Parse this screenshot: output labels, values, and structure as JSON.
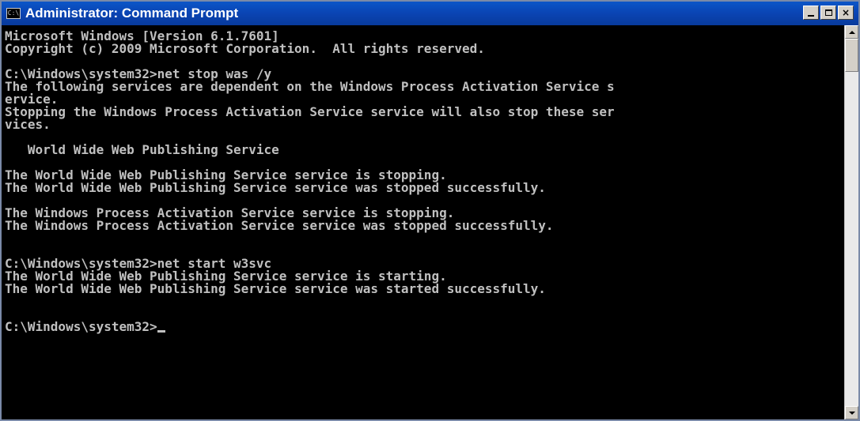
{
  "window": {
    "title": "Administrator: Command Prompt",
    "app_icon_text": "C:\\",
    "buttons": {
      "minimize": "minimize",
      "maximize": "maximize",
      "close": "×"
    }
  },
  "console": {
    "lines": [
      "Microsoft Windows [Version 6.1.7601]",
      "Copyright (c) 2009 Microsoft Corporation.  All rights reserved.",
      "",
      "C:\\Windows\\system32>net stop was /y",
      "The following services are dependent on the Windows Process Activation Service s",
      "ervice.",
      "Stopping the Windows Process Activation Service service will also stop these ser",
      "vices.",
      "",
      "   World Wide Web Publishing Service",
      "",
      "The World Wide Web Publishing Service service is stopping.",
      "The World Wide Web Publishing Service service was stopped successfully.",
      "",
      "The Windows Process Activation Service service is stopping.",
      "The Windows Process Activation Service service was stopped successfully.",
      "",
      "",
      "C:\\Windows\\system32>net start w3svc",
      "The World Wide Web Publishing Service service is starting.",
      "The World Wide Web Publishing Service service was started successfully.",
      "",
      ""
    ],
    "prompt": "C:\\Windows\\system32>"
  },
  "colors": {
    "titlebar": "#0a44b3",
    "console_background": "#000000",
    "console_text": "#c0c0c0"
  }
}
